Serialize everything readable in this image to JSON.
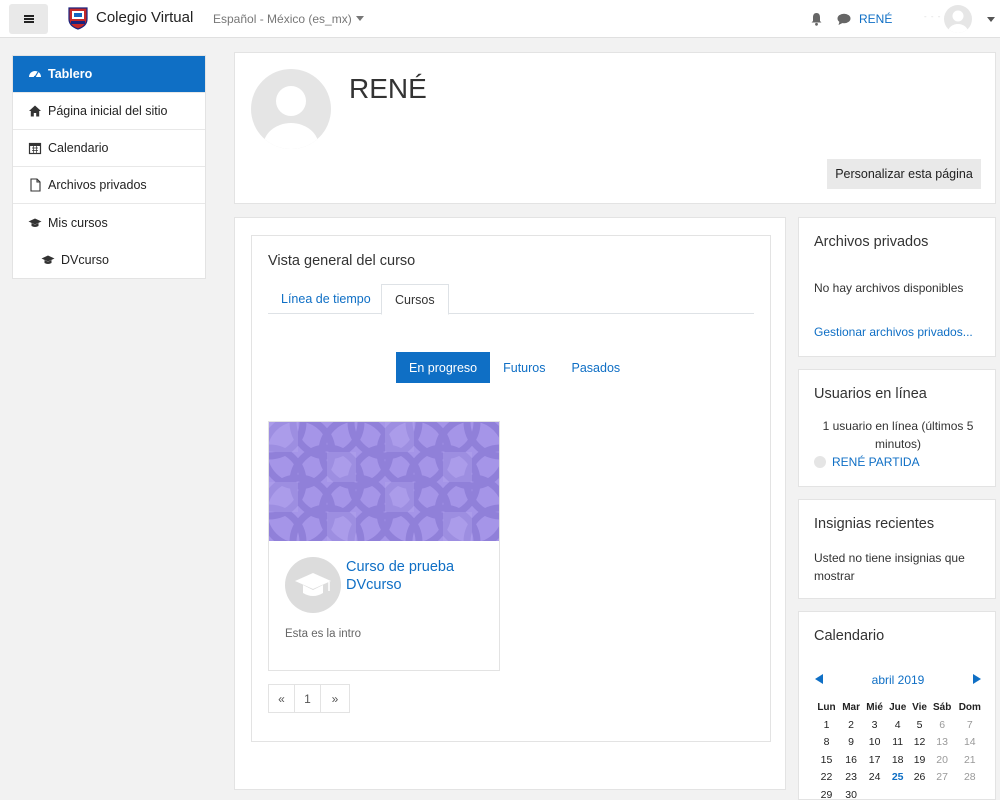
{
  "navbar": {
    "site_name": "Colegio Virtual",
    "language": "Español - México (es_mx)",
    "user_name": "RENÉ"
  },
  "sidebar": {
    "items": [
      {
        "label": "Tablero",
        "icon": "dashboard-icon",
        "active": true
      },
      {
        "label": "Página inicial del sitio",
        "icon": "home-icon"
      },
      {
        "label": "Calendario",
        "icon": "calendar-icon"
      },
      {
        "label": "Archivos privados",
        "icon": "file-icon"
      },
      {
        "label": "Mis cursos",
        "icon": "graduation-cap-icon"
      },
      {
        "label": "DVcurso",
        "icon": "graduation-cap-icon"
      }
    ]
  },
  "header": {
    "user_full_name": "RENÉ",
    "customize_button": "Personalizar esta página"
  },
  "course_overview": {
    "title": "Vista general del curso",
    "tabs": [
      "Línea de tiempo",
      "Cursos"
    ],
    "active_tab": "Cursos",
    "filters": [
      "En progreso",
      "Futuros",
      "Pasados"
    ],
    "active_filter": "En progreso",
    "course": {
      "name": "Curso de prueba DVcurso",
      "summary": "Esta es la intro"
    },
    "pagination": [
      "«",
      "1",
      "»"
    ]
  },
  "blocks": {
    "private_files": {
      "title": "Archivos privados",
      "empty_text": "No hay archivos disponibles",
      "manage_link": "Gestionar archivos privados..."
    },
    "online_users": {
      "title": "Usuarios en línea",
      "summary": "1 usuario en línea (últimos 5 minutos)",
      "user": "RENÉ PARTIDA"
    },
    "badges": {
      "title": "Insignias recientes",
      "empty_text": "Usted no tiene insignias que mostrar"
    },
    "calendar": {
      "title": "Calendario",
      "month": "abril 2019",
      "weekdays": [
        "Lun",
        "Mar",
        "Mié",
        "Jue",
        "Vie",
        "Sáb",
        "Dom"
      ],
      "weeks": [
        [
          "1",
          "2",
          "3",
          "4",
          "5",
          "6",
          "7"
        ],
        [
          "8",
          "9",
          "10",
          "11",
          "12",
          "13",
          "14"
        ],
        [
          "15",
          "16",
          "17",
          "18",
          "19",
          "20",
          "21"
        ],
        [
          "22",
          "23",
          "24",
          "25",
          "26",
          "27",
          "28"
        ],
        [
          "29",
          "30",
          "",
          "",
          "",
          "",
          ""
        ]
      ],
      "today": "25"
    }
  },
  "colors": {
    "accent": "#0f6fc5",
    "course_image": "#a595e8"
  }
}
